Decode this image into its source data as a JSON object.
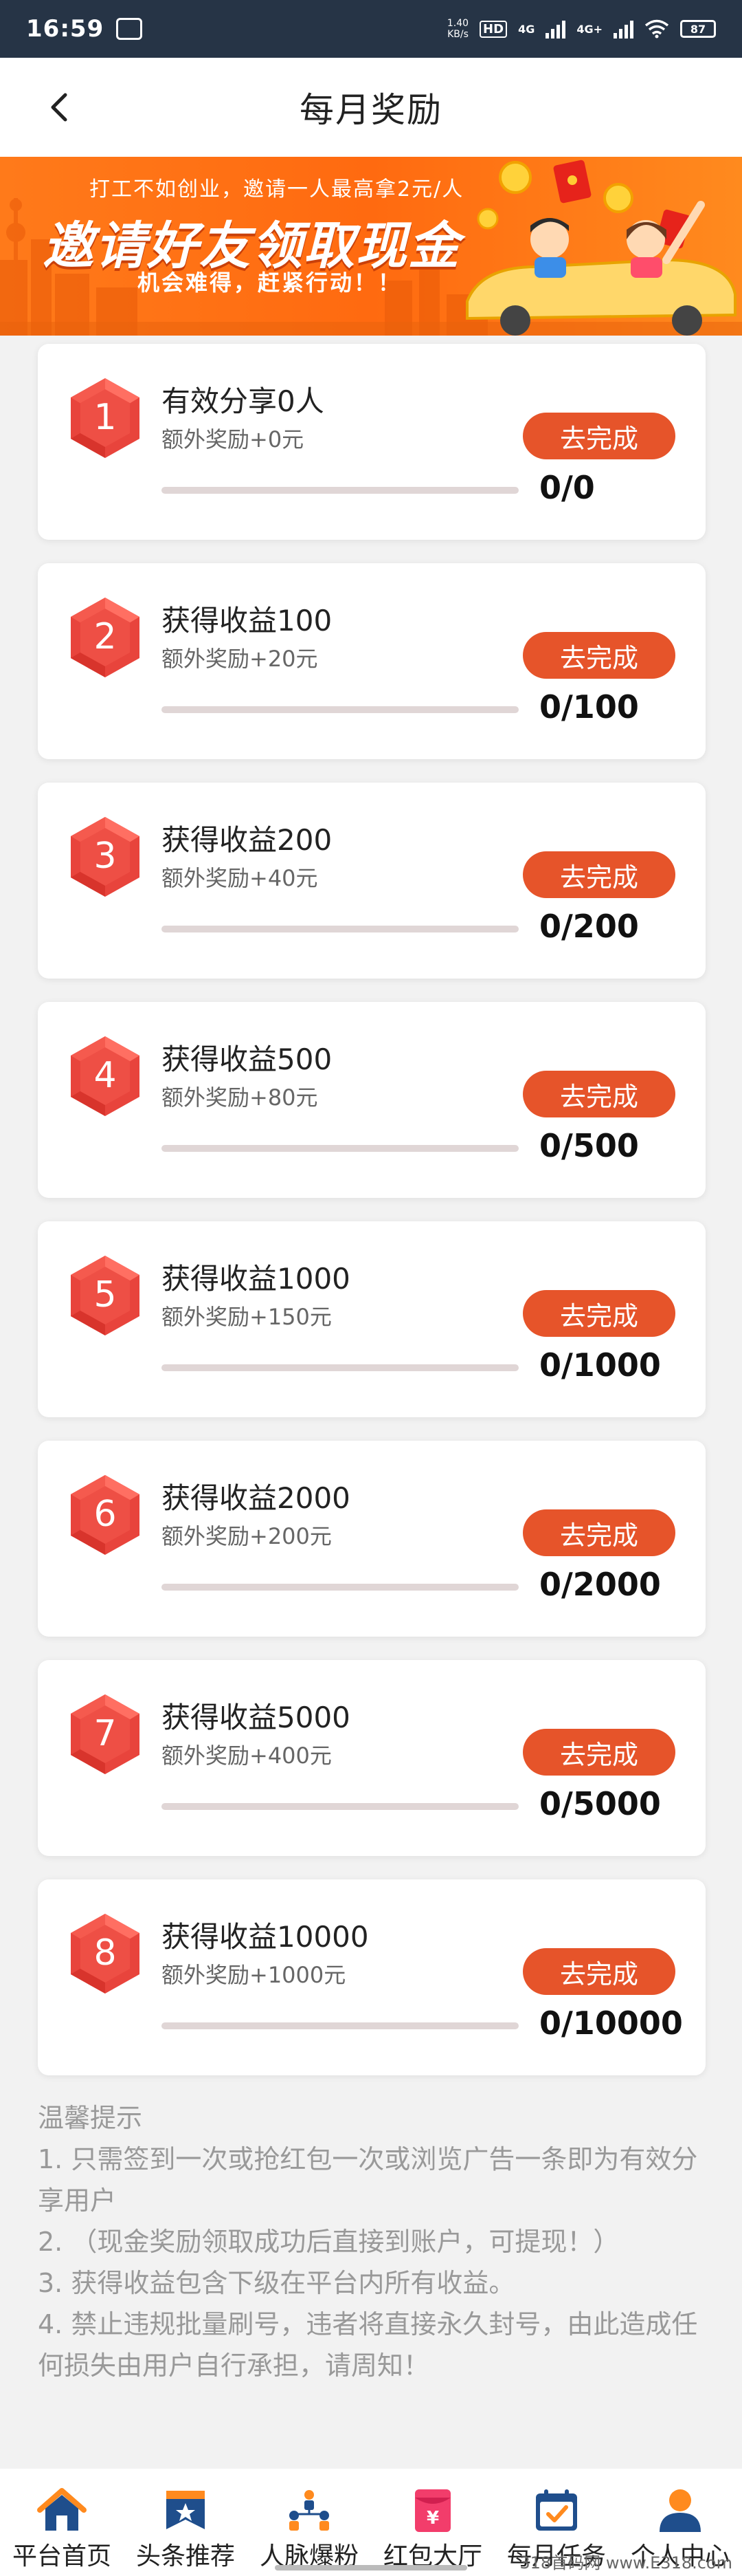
{
  "status_bar": {
    "time": "16:59",
    "speed": "1.40\nKB/s",
    "network_labels": [
      "HD",
      "4G",
      "4G+"
    ],
    "battery": "87"
  },
  "header": {
    "title": "每月奖励"
  },
  "banner": {
    "line1": "打工不如创业，邀请一人最高拿2元/人",
    "line2": "邀请好友领取现金",
    "line3": "机会难得，赶紧行动！！"
  },
  "tasks": [
    {
      "number": "1",
      "title": "有效分享0人",
      "bonus": "额外奖励+0元",
      "button": "去完成",
      "count": "0/0",
      "progress": 0
    },
    {
      "number": "2",
      "title": "获得收益100",
      "bonus": "额外奖励+20元",
      "button": "去完成",
      "count": "0/100",
      "progress": 0
    },
    {
      "number": "3",
      "title": "获得收益200",
      "bonus": "额外奖励+40元",
      "button": "去完成",
      "count": "0/200",
      "progress": 0
    },
    {
      "number": "4",
      "title": "获得收益500",
      "bonus": "额外奖励+80元",
      "button": "去完成",
      "count": "0/500",
      "progress": 0
    },
    {
      "number": "5",
      "title": "获得收益1000",
      "bonus": "额外奖励+150元",
      "button": "去完成",
      "count": "0/1000",
      "progress": 0
    },
    {
      "number": "6",
      "title": "获得收益2000",
      "bonus": "额外奖励+200元",
      "button": "去完成",
      "count": "0/2000",
      "progress": 0
    },
    {
      "number": "7",
      "title": "获得收益5000",
      "bonus": "额外奖励+400元",
      "button": "去完成",
      "count": "0/5000",
      "progress": 0
    },
    {
      "number": "8",
      "title": "获得收益10000",
      "bonus": "额外奖励+1000元",
      "button": "去完成",
      "count": "0/10000",
      "progress": 0
    }
  ],
  "tips": {
    "title": "温馨提示",
    "items": [
      "1. 只需签到一次或抢红包一次或浏览广告一条即为有效分享用户",
      "2. （现金奖励领取成功后直接到账户，可提现！）",
      "3. 获得收益包含下级在平台内所有收益。",
      "4. 禁止违规批量刷号，违者将直接永久封号，由此造成任何损失由用户自行承担，请周知！"
    ]
  },
  "bottom_nav": [
    {
      "label": "平台首页",
      "icon": "home-icon"
    },
    {
      "label": "头条推荐",
      "icon": "headline-icon"
    },
    {
      "label": "人脉爆粉",
      "icon": "network-icon"
    },
    {
      "label": "红包大厅",
      "icon": "red-envelope-icon"
    },
    {
      "label": "每月任务",
      "icon": "calendar-task-icon"
    },
    {
      "label": "个人中心",
      "icon": "user-icon"
    }
  ],
  "watermark": "318首码网 www.E318.com",
  "colors": {
    "accent": "#e6542a",
    "status_bar": "#263446",
    "banner": "#ff6a10",
    "badge": "#f0524a"
  }
}
